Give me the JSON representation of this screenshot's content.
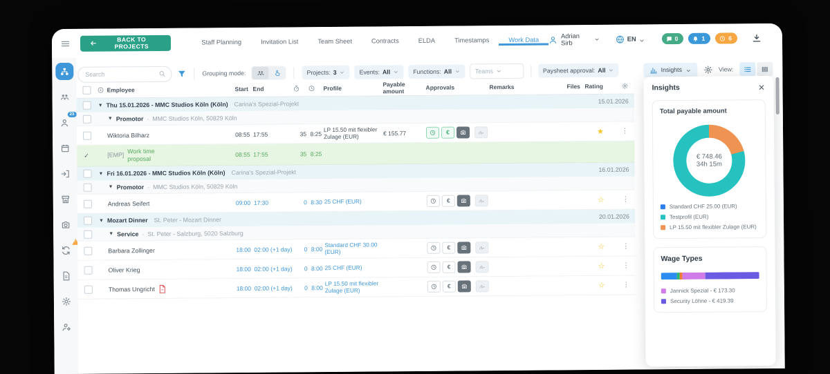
{
  "colors": {
    "accent_blue": "#3e97d9",
    "back_button_green": "#2aa187",
    "group_row_bg": "#e8f4f8",
    "proposal_row_bg": "#e7f6e3",
    "proposal_text_green": "#57a95d",
    "star_yellow": "#f6c523"
  },
  "topbar": {
    "back_button": "BACK TO PROJECTS",
    "tabs": [
      "Staff Planning",
      "Invitation List",
      "Team Sheet",
      "Contracts",
      "ELDA",
      "Timestamps",
      "Work Data"
    ],
    "active_tab": "Work Data",
    "user_name": "Adrian Sirb",
    "language": "EN",
    "badges": [
      {
        "icon": "chat-icon",
        "count": "0",
        "color": "#45ab85"
      },
      {
        "icon": "bell-icon",
        "count": "1",
        "color": "#3b98d8"
      },
      {
        "icon": "clock-icon",
        "count": "6",
        "color": "#f6a742"
      }
    ]
  },
  "sidebar": {
    "items": [
      {
        "icon": "org-chart-icon",
        "active": true
      },
      {
        "icon": "team-icon"
      },
      {
        "icon": "person-badge-icon",
        "badge": "23"
      },
      {
        "icon": "calendar-icon"
      },
      {
        "icon": "sign-in-icon"
      },
      {
        "icon": "kiosk-icon"
      },
      {
        "icon": "camera-icon"
      },
      {
        "icon": "sync-icon",
        "warning": true
      },
      {
        "icon": "document-icon"
      },
      {
        "icon": "settings-icon"
      },
      {
        "icon": "user-settings-icon"
      }
    ]
  },
  "toolbar": {
    "search_placeholder": "Search",
    "grouping_label": "Grouping mode:",
    "dropdowns": [
      {
        "label": "Projects:",
        "value": "3",
        "style": "filled"
      },
      {
        "label": "Events:",
        "value": "All",
        "style": "filled"
      },
      {
        "label": "Functions:",
        "value": "All",
        "style": "filled"
      },
      {
        "label": "Teams",
        "value": "",
        "style": "outline"
      },
      {
        "label": "Paysheet approval:",
        "value": "All",
        "style": "filled"
      }
    ],
    "insights_label": "Insights",
    "view_label": "View:"
  },
  "table": {
    "header": {
      "employee": "Employee",
      "start": "Start",
      "end": "End",
      "profile": "Profile",
      "payable": "Payable amount",
      "approvals": "Approvals",
      "remarks": "Remarks",
      "files": "Files",
      "rating": "Rating"
    },
    "rows": [
      {
        "type": "group",
        "title": "Thu 15.01.2026 - MMC Studios Köln (Köln)",
        "subtitle": "Carina's Spezial-Projekt",
        "date": "15.01.2026"
      },
      {
        "type": "subgroup",
        "title": "Promotor",
        "subtitle": "MMC Studios Köln, 50829 Köln"
      },
      {
        "type": "employee",
        "name": "Wiktoria Bilharz",
        "start": "08:55",
        "end": "17:55",
        "break": "35",
        "hours": "8:25",
        "profile": "LP 15.50 mit flexibler Zulage (EUR)",
        "payable": "€ 155.77",
        "time_style": "plain",
        "profile_style": "plain",
        "star": "filled",
        "approvals": [
          {
            "icon": "clock-icon",
            "state": "approved"
          },
          {
            "icon": "euro-icon",
            "state": "approved"
          },
          {
            "icon": "camera-icon",
            "state": "dark"
          },
          {
            "icon": "signature-icon",
            "state": "muted"
          }
        ]
      },
      {
        "type": "proposal",
        "tag": "[EMP]",
        "label": "Work time proposal",
        "start": "08:55",
        "end": "17:55",
        "break": "35",
        "hours": "8:25"
      },
      {
        "type": "group",
        "title": "Fri 16.01.2026 - MMC Studios Köln (Köln)",
        "subtitle": "Carina's Spezial-Projekt",
        "date": "16.01.2026"
      },
      {
        "type": "subgroup",
        "title": "Promotor",
        "subtitle": "MMC Studios Köln, 50829 Köln"
      },
      {
        "type": "employee",
        "name": "Andreas Seifert",
        "start": "09:00",
        "end": "17:30",
        "break": "0",
        "hours": "8:30",
        "profile": "25 CHF (EUR)",
        "payable": "",
        "time_style": "link",
        "profile_style": "link",
        "star": "outline",
        "approvals": [
          {
            "icon": "clock-icon",
            "state": "neutral"
          },
          {
            "icon": "euro-icon",
            "state": "neutral"
          },
          {
            "icon": "camera-icon",
            "state": "dark"
          },
          {
            "icon": "signature-icon",
            "state": "muted"
          }
        ]
      },
      {
        "type": "group",
        "title": "Mozart Dinner",
        "subtitle": "St. Peter - Mozart Dinner",
        "date": "20.01.2026"
      },
      {
        "type": "subgroup",
        "title": "Service",
        "subtitle": "St. Peter - Salzburg, 5020 Salzburg"
      },
      {
        "type": "employee",
        "name": "Barbara Zollinger",
        "start": "18:00",
        "end": "02:00 (+1 day)",
        "break": "0",
        "hours": "8:00",
        "profile": "Standard CHF 30.00 (EUR)",
        "payable": "",
        "time_style": "link",
        "profile_style": "link",
        "star": "outline",
        "approvals": [
          {
            "icon": "clock-icon",
            "state": "neutral"
          },
          {
            "icon": "euro-icon",
            "state": "neutral"
          },
          {
            "icon": "camera-icon",
            "state": "dark"
          },
          {
            "icon": "signature-icon",
            "state": "muted"
          }
        ]
      },
      {
        "type": "employee",
        "name": "Oliver Krieg",
        "start": "18:00",
        "end": "02:00 (+1 day)",
        "break": "0",
        "hours": "8:00",
        "profile": "25 CHF (EUR)",
        "payable": "",
        "time_style": "link",
        "profile_style": "link",
        "star": "outline",
        "approvals": [
          {
            "icon": "clock-icon",
            "state": "neutral"
          },
          {
            "icon": "euro-icon",
            "state": "neutral"
          },
          {
            "icon": "camera-icon",
            "state": "dark"
          },
          {
            "icon": "signature-icon",
            "state": "muted"
          }
        ]
      },
      {
        "type": "employee",
        "name": "Thomas Ungricht",
        "file_icon": "pdf-file-icon",
        "start": "18:00",
        "end": "02:00 (+1 day)",
        "break": "0",
        "hours": "8:00",
        "profile": "LP 15.50 mit flexibler Zulage (EUR)",
        "payable": "",
        "time_style": "link",
        "profile_style": "link",
        "star": "outline",
        "approvals": [
          {
            "icon": "clock-icon",
            "state": "neutral"
          },
          {
            "icon": "euro-icon",
            "state": "neutral"
          },
          {
            "icon": "camera-icon",
            "state": "dark"
          },
          {
            "icon": "signature-icon",
            "state": "muted"
          }
        ]
      }
    ]
  },
  "insights_panel": {
    "title": "Insights"
  },
  "chart_data": [
    {
      "type": "pie",
      "title": "Total payable amount",
      "center_label": "€ 748.46",
      "center_sublabel": "34h 15m",
      "legend_position": "bottom",
      "series": [
        {
          "name": "Standard CHF 25.00 (EUR)",
          "value": 0,
          "color": "#2d7ff0"
        },
        {
          "name": "Testprofil (EUR)",
          "value": 592.69,
          "color": "#25c2c0"
        },
        {
          "name": "LP 15.50 mit flexibler Zulage (EUR)",
          "value": 155.77,
          "color": "#ef9353"
        }
      ]
    },
    {
      "type": "bar",
      "title": "Wage Types",
      "segments": [
        {
          "color": "#2d8cf0",
          "pct": 16
        },
        {
          "color": "#2bb673",
          "pct": 3
        },
        {
          "color": "#f0783a",
          "pct": 3
        },
        {
          "color": "#cf7ce8",
          "pct": 23,
          "label": "Jannick Spezial - € 173.30"
        },
        {
          "color": "#6a5be2",
          "pct": 55,
          "label": "Security Löhne - € 419.39"
        }
      ],
      "legend": [
        {
          "label": "Jannick Spezial - € 173.30",
          "color": "#cf7ce8"
        },
        {
          "label": "Security Löhne - € 419.39",
          "color": "#6a5be2"
        }
      ]
    }
  ]
}
